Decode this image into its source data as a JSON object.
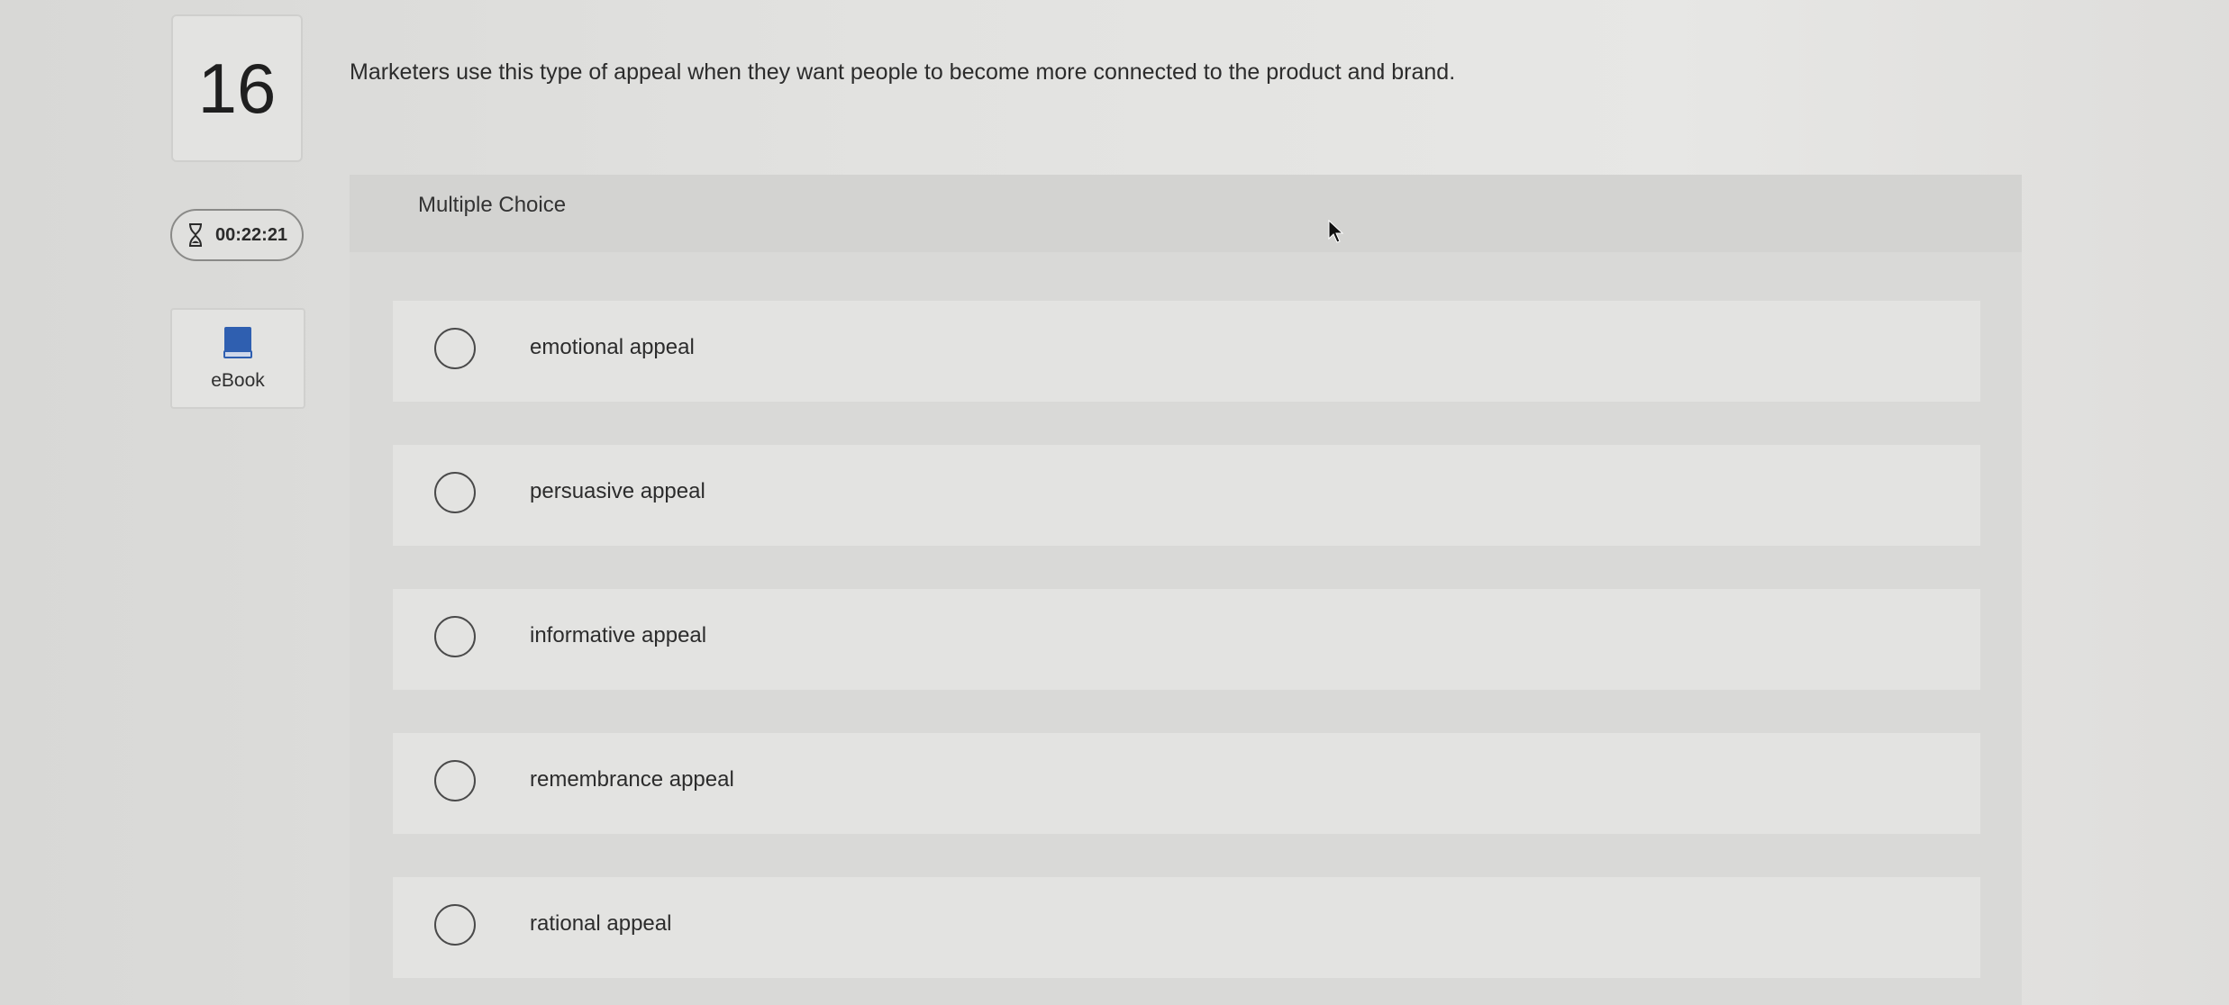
{
  "question": {
    "number": "16",
    "text": "Marketers use this type of appeal when they want people to become more connected to the product and brand."
  },
  "timer": {
    "icon": "hourglass-icon",
    "value": "00:22:21"
  },
  "ebook": {
    "icon": "book-icon",
    "label": "eBook",
    "color": "#2f5fb0"
  },
  "panel": {
    "title": "Multiple Choice"
  },
  "options": [
    {
      "label": "emotional appeal",
      "selected": false
    },
    {
      "label": "persuasive appeal",
      "selected": false
    },
    {
      "label": "informative appeal",
      "selected": false
    },
    {
      "label": "remembrance appeal",
      "selected": false
    },
    {
      "label": "rational appeal",
      "selected": false
    }
  ]
}
